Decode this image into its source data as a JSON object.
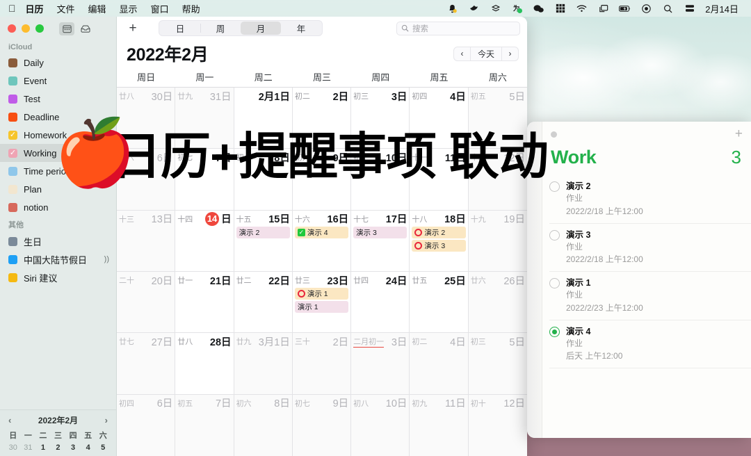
{
  "menubar": {
    "apple": "apple-logo",
    "items": [
      "日历",
      "文件",
      "编辑",
      "显示",
      "窗口",
      "帮助"
    ],
    "status_icons": [
      "notification-bell-icon",
      "bird-icon",
      "layers-icon",
      "shortcut-icon",
      "wechat-icon",
      "input-method-pinyin-icon",
      "wifi-icon",
      "screen-mirroring-icon",
      "battery-charging-icon",
      "control-center-icon",
      "spotlight-search-icon",
      "server-icon"
    ],
    "clock": "2月14日"
  },
  "sidebar": {
    "icloud_label": "iCloud",
    "other_label": "其他",
    "window_buttons": [
      "close-button",
      "minimize-button",
      "zoom-button"
    ],
    "toggle_buttons": [
      "calendar-view-button",
      "inbox-button"
    ],
    "icloud_calendars": [
      {
        "name": "Daily",
        "color": "#8a5c3b",
        "checked": false,
        "selected": false
      },
      {
        "name": "Event",
        "color": "#6ec6bc",
        "checked": false,
        "selected": false
      },
      {
        "name": "Test",
        "color": "#c05ce8",
        "checked": false,
        "selected": false
      },
      {
        "name": "Deadline",
        "color": "#f74f12",
        "checked": false,
        "selected": false
      },
      {
        "name": "Homework",
        "color": "#f6c52b",
        "checked": true,
        "selected": false
      },
      {
        "name": "Working",
        "color": "#efa4b4",
        "checked": true,
        "selected": true
      },
      {
        "name": "Time period",
        "color": "#8fc7ea",
        "checked": false,
        "selected": false
      },
      {
        "name": "Plan",
        "color": "#f2e6cf",
        "checked": false,
        "selected": false
      },
      {
        "name": "notion",
        "color": "#d7695c",
        "checked": false,
        "selected": false
      }
    ],
    "other_calendars": [
      {
        "name": "生日",
        "color": "#7b8a99",
        "checked": false,
        "sound": false
      },
      {
        "name": "中国大陆节假日",
        "color": "#1ea0f5",
        "checked": false,
        "sound": true
      },
      {
        "name": "Siri 建议",
        "color": "#f5b912",
        "checked": false,
        "sound": false
      }
    ],
    "minicalendar": {
      "title": "2022年2月",
      "prev": "‹",
      "next": "›",
      "weekdays": [
        "日",
        "一",
        "二",
        "三",
        "四",
        "五",
        "六"
      ],
      "days": [
        {
          "n": "30",
          "out": true
        },
        {
          "n": "31",
          "out": true
        },
        {
          "n": "1",
          "out": false
        },
        {
          "n": "2",
          "out": false
        },
        {
          "n": "3",
          "out": false
        },
        {
          "n": "4",
          "out": false
        },
        {
          "n": "5",
          "out": false
        }
      ]
    }
  },
  "toolbar": {
    "add_label": "+",
    "views": [
      {
        "label": "日",
        "active": false
      },
      {
        "label": "周",
        "active": false
      },
      {
        "label": "月",
        "active": true
      },
      {
        "label": "年",
        "active": false
      }
    ],
    "search_placeholder": "搜索",
    "title": "2022年2月",
    "prev": "‹",
    "today_label": "今天",
    "next": "›"
  },
  "calendar": {
    "weekdays": [
      "周日",
      "周一",
      "周二",
      "周三",
      "周四",
      "周五",
      "周六"
    ],
    "weeks": [
      [
        {
          "lunar": "廿八",
          "day": "30日",
          "dim": true,
          "today": false,
          "events": []
        },
        {
          "lunar": "廿九",
          "day": "31日",
          "dim": true,
          "today": false,
          "events": []
        },
        {
          "lunar": "",
          "day": "2月1日",
          "dim": false,
          "today": false,
          "events": []
        },
        {
          "lunar": "初二",
          "day": "2日",
          "dim": false,
          "today": false,
          "events": []
        },
        {
          "lunar": "初三",
          "day": "3日",
          "dim": false,
          "today": false,
          "events": []
        },
        {
          "lunar": "初四",
          "day": "4日",
          "dim": false,
          "today": false,
          "events": []
        },
        {
          "lunar": "初五",
          "day": "5日",
          "dim": true,
          "today": false,
          "events": []
        }
      ],
      [
        {
          "lunar": "初六",
          "day": "6日",
          "dim": true,
          "today": false,
          "events": []
        },
        {
          "lunar": "初七",
          "day": "7日",
          "dim": false,
          "today": false,
          "events": []
        },
        {
          "lunar": "初八",
          "day": "8日",
          "dim": false,
          "today": false,
          "events": []
        },
        {
          "lunar": "初九",
          "day": "9日",
          "dim": false,
          "today": false,
          "events": []
        },
        {
          "lunar": "初十",
          "day": "10日",
          "dim": false,
          "today": false,
          "events": []
        },
        {
          "lunar": "十一",
          "day": "11日",
          "dim": false,
          "today": false,
          "events": []
        },
        {
          "lunar": "十二",
          "day": "12日",
          "dim": true,
          "today": false,
          "events": []
        }
      ],
      [
        {
          "lunar": "十三",
          "day": "13日",
          "dim": true,
          "today": false,
          "events": []
        },
        {
          "lunar": "十四",
          "day": "14日",
          "dim": false,
          "today": true,
          "events": []
        },
        {
          "lunar": "十五",
          "day": "15日",
          "dim": false,
          "today": false,
          "events": [
            {
              "title": "演示 2",
              "style": "pink",
              "mark": "none"
            }
          ]
        },
        {
          "lunar": "十六",
          "day": "16日",
          "dim": false,
          "today": false,
          "events": [
            {
              "title": "演示 4",
              "style": "cream",
              "mark": "check"
            }
          ]
        },
        {
          "lunar": "十七",
          "day": "17日",
          "dim": false,
          "today": false,
          "events": [
            {
              "title": "演示 3",
              "style": "pink",
              "mark": "none"
            }
          ]
        },
        {
          "lunar": "十八",
          "day": "18日",
          "dim": false,
          "today": false,
          "events": [
            {
              "title": "演示 2",
              "style": "cream",
              "mark": "circle"
            },
            {
              "title": "演示 3",
              "style": "cream",
              "mark": "circle"
            }
          ]
        },
        {
          "lunar": "十九",
          "day": "19日",
          "dim": true,
          "today": false,
          "events": []
        }
      ],
      [
        {
          "lunar": "二十",
          "day": "20日",
          "dim": true,
          "today": false,
          "events": []
        },
        {
          "lunar": "廿一",
          "day": "21日",
          "dim": false,
          "today": false,
          "events": []
        },
        {
          "lunar": "廿二",
          "day": "22日",
          "dim": false,
          "today": false,
          "events": []
        },
        {
          "lunar": "廿三",
          "day": "23日",
          "dim": false,
          "today": false,
          "events": [
            {
              "title": "演示 1",
              "style": "cream",
              "mark": "circle"
            },
            {
              "title": "演示 1",
              "style": "pink",
              "mark": "none"
            }
          ]
        },
        {
          "lunar": "廿四",
          "day": "24日",
          "dim": false,
          "today": false,
          "events": []
        },
        {
          "lunar": "廿五",
          "day": "25日",
          "dim": false,
          "today": false,
          "events": []
        },
        {
          "lunar": "廿六",
          "day": "26日",
          "dim": true,
          "today": false,
          "events": []
        }
      ],
      [
        {
          "lunar": "廿七",
          "day": "27日",
          "dim": true,
          "today": false,
          "events": []
        },
        {
          "lunar": "廿八",
          "day": "28日",
          "dim": false,
          "today": false,
          "events": []
        },
        {
          "lunar": "廿九",
          "day": "3月1日",
          "dim": true,
          "today": false,
          "events": []
        },
        {
          "lunar": "三十",
          "day": "2日",
          "dim": true,
          "today": false,
          "events": []
        },
        {
          "lunar": "二月初一",
          "day": "3日",
          "dim": true,
          "today": false,
          "festival": true,
          "events": []
        },
        {
          "lunar": "初二",
          "day": "4日",
          "dim": true,
          "today": false,
          "events": []
        },
        {
          "lunar": "初三",
          "day": "5日",
          "dim": true,
          "today": false,
          "events": []
        }
      ],
      [
        {
          "lunar": "初四",
          "day": "6日",
          "dim": true,
          "today": false,
          "events": []
        },
        {
          "lunar": "初五",
          "day": "7日",
          "dim": true,
          "today": false,
          "events": []
        },
        {
          "lunar": "初六",
          "day": "8日",
          "dim": true,
          "today": false,
          "events": []
        },
        {
          "lunar": "初七",
          "day": "9日",
          "dim": true,
          "today": false,
          "events": []
        },
        {
          "lunar": "初八",
          "day": "10日",
          "dim": true,
          "today": false,
          "events": []
        },
        {
          "lunar": "初九",
          "day": "11日",
          "dim": true,
          "today": false,
          "events": []
        },
        {
          "lunar": "初十",
          "day": "12日",
          "dim": true,
          "today": false,
          "events": []
        }
      ]
    ]
  },
  "reminders": {
    "title": "Work",
    "count": "3",
    "add_label": "+",
    "accent": "#23b14b",
    "items": [
      {
        "title": "演示 2",
        "note": "作业",
        "date": "2022/2/18 上午12:00",
        "done": false
      },
      {
        "title": "演示 3",
        "note": "作业",
        "date": "2022/2/18 上午12:00",
        "done": false
      },
      {
        "title": "演示 1",
        "note": "作业",
        "date": "2022/2/23 上午12:00",
        "done": false
      },
      {
        "title": "演示 4",
        "note": "作业",
        "date": "后天 上午12:00",
        "done": true
      }
    ]
  },
  "overlay": {
    "text": "日历+提醒事项 联动",
    "emoji": "🍎"
  }
}
